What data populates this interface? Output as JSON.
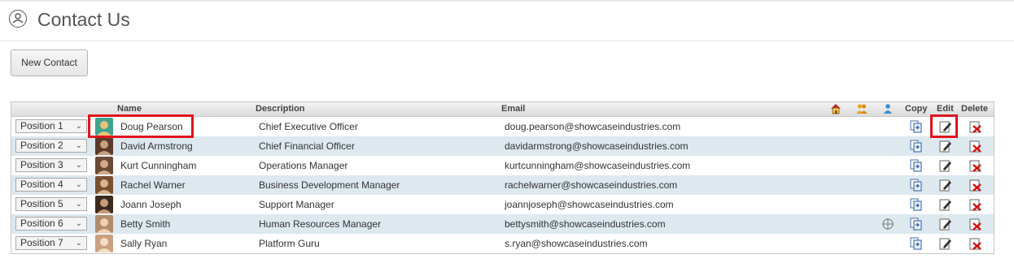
{
  "header": {
    "title": "Contact Us"
  },
  "toolbar": {
    "new_contact_label": "New Contact"
  },
  "table": {
    "columns": {
      "name": "Name",
      "description": "Description",
      "email": "Email",
      "copy": "Copy",
      "edit": "Edit",
      "delete": "Delete"
    },
    "icon_columns": [
      "home-icon",
      "group-icon",
      "person-icon"
    ],
    "rows": [
      {
        "position": "Position 1",
        "name": "Doug Pearson",
        "description": "Chief Executive Officer",
        "email": "doug.pearson@showcaseindustries.com"
      },
      {
        "position": "Position 2",
        "name": "David Armstrong",
        "description": "Chief Financial Officer",
        "email": "davidarmstrong@showcaseindustries.com"
      },
      {
        "position": "Position 3",
        "name": "Kurt Cunningham",
        "description": "Operations Manager",
        "email": "kurtcunningham@showcaseindustries.com"
      },
      {
        "position": "Position 4",
        "name": "Rachel Warner",
        "description": "Business Development Manager",
        "email": "rachelwarner@showcaseindustries.com"
      },
      {
        "position": "Position 5",
        "name": "Joann Joseph",
        "description": "Support Manager",
        "email": "joannjoseph@showcaseindustries.com"
      },
      {
        "position": "Position 6",
        "name": "Betty Smith",
        "description": "Human Resources Manager",
        "email": "bettysmith@showcaseindustries.com"
      },
      {
        "position": "Position 7",
        "name": "Sally Ryan",
        "description": "Platform Guru",
        "email": "s.ryan@showcaseindustries.com"
      }
    ]
  },
  "colors": {
    "row_alt": "#dde8ef",
    "highlight": "#e0141b",
    "header_grad": "#dcdcdc"
  }
}
